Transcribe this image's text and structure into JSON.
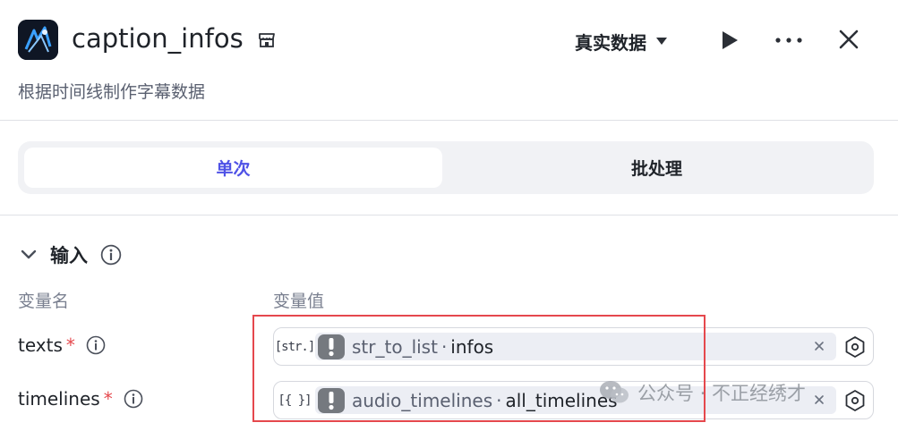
{
  "header": {
    "title": "caption_infos",
    "subtitle": "根据时间线制作字幕数据",
    "data_source": "真实数据",
    "icon": "plugin-logo-icon"
  },
  "mode_tabs": [
    {
      "label": "单次",
      "active": true
    },
    {
      "label": "批处理",
      "active": false
    }
  ],
  "input_section": {
    "title": "输入",
    "col_name": "变量名",
    "col_value": "变量值",
    "rows": [
      {
        "name": "texts",
        "required_mark": "*",
        "type_tag": "[str.]",
        "ref_node": "str_to_list",
        "ref_sep": "·",
        "ref_field": "infos"
      },
      {
        "name": "timelines",
        "required_mark": "*",
        "type_tag": "[{ }]",
        "ref_node": "audio_timelines",
        "ref_sep": "·",
        "ref_field": "all_timelines"
      }
    ]
  },
  "watermark": {
    "text": "公众号 · 不正经绣才"
  },
  "colors": {
    "accent": "#4f52e6",
    "required": "#e5484d",
    "highlight": "#e5484d",
    "chip_bg": "#eceef4"
  }
}
